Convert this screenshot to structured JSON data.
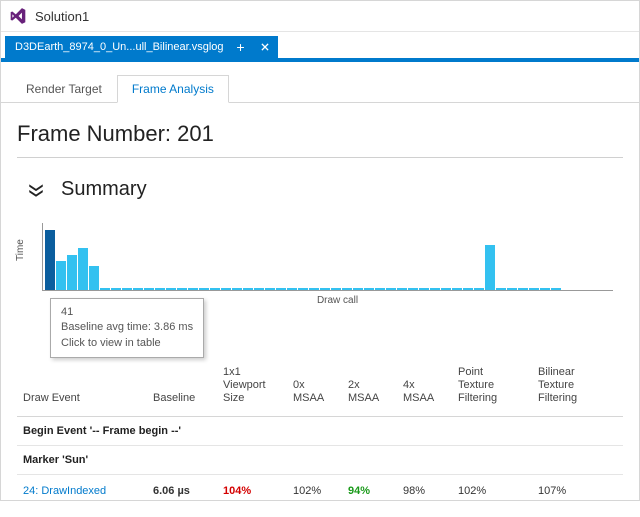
{
  "titlebar": {
    "title": "Solution1"
  },
  "doc_tab": {
    "label": "D3DEarth_8974_0_Un...ull_Bilinear.vsglog"
  },
  "subtabs": {
    "render_target": "Render Target",
    "frame_analysis": "Frame Analysis"
  },
  "frame_header": "Frame Number: 201",
  "summary_label": "Summary",
  "chart_axis": {
    "y": "Time",
    "x": "Draw call"
  },
  "tooltip": {
    "line1": "41",
    "line2": "Baseline avg time: 3.86 ms",
    "line3": "Click to view in table"
  },
  "columns": {
    "draw_event": "Draw Event",
    "baseline": "Baseline",
    "viewport": "1x1\nViewport\nSize",
    "msaa0": "0x\nMSAA",
    "msaa2": "2x\nMSAA",
    "msaa4": "4x\nMSAA",
    "point": "Point\nTexture\nFiltering",
    "bilinear": "Bilinear\nTexture\nFiltering"
  },
  "subhead1": "Begin Event '-- Frame begin --'",
  "subhead2": "Marker 'Sun'",
  "row1": {
    "name": "24: DrawIndexed",
    "baseline": "6.06 µs",
    "viewport": "104%",
    "msaa0": "102%",
    "msaa2": "94%",
    "msaa4": "98%",
    "point": "102%",
    "bilinear": "107%"
  },
  "chart_data": {
    "type": "bar",
    "xlabel": "Draw call",
    "ylabel": "Time",
    "tooltip_index": 0,
    "tooltip_value": "41",
    "tooltip_avg": "3.86 ms",
    "bars_relative_heights": [
      100,
      48,
      58,
      70,
      40,
      0,
      0,
      0,
      0,
      0,
      0,
      0,
      0,
      0,
      0,
      0,
      0,
      0,
      0,
      0,
      0,
      0,
      0,
      0,
      0,
      0,
      0,
      0,
      0,
      0,
      0,
      0,
      0,
      0,
      0,
      0,
      0,
      0,
      0,
      0,
      75,
      0,
      0,
      0,
      0,
      0,
      0
    ]
  }
}
